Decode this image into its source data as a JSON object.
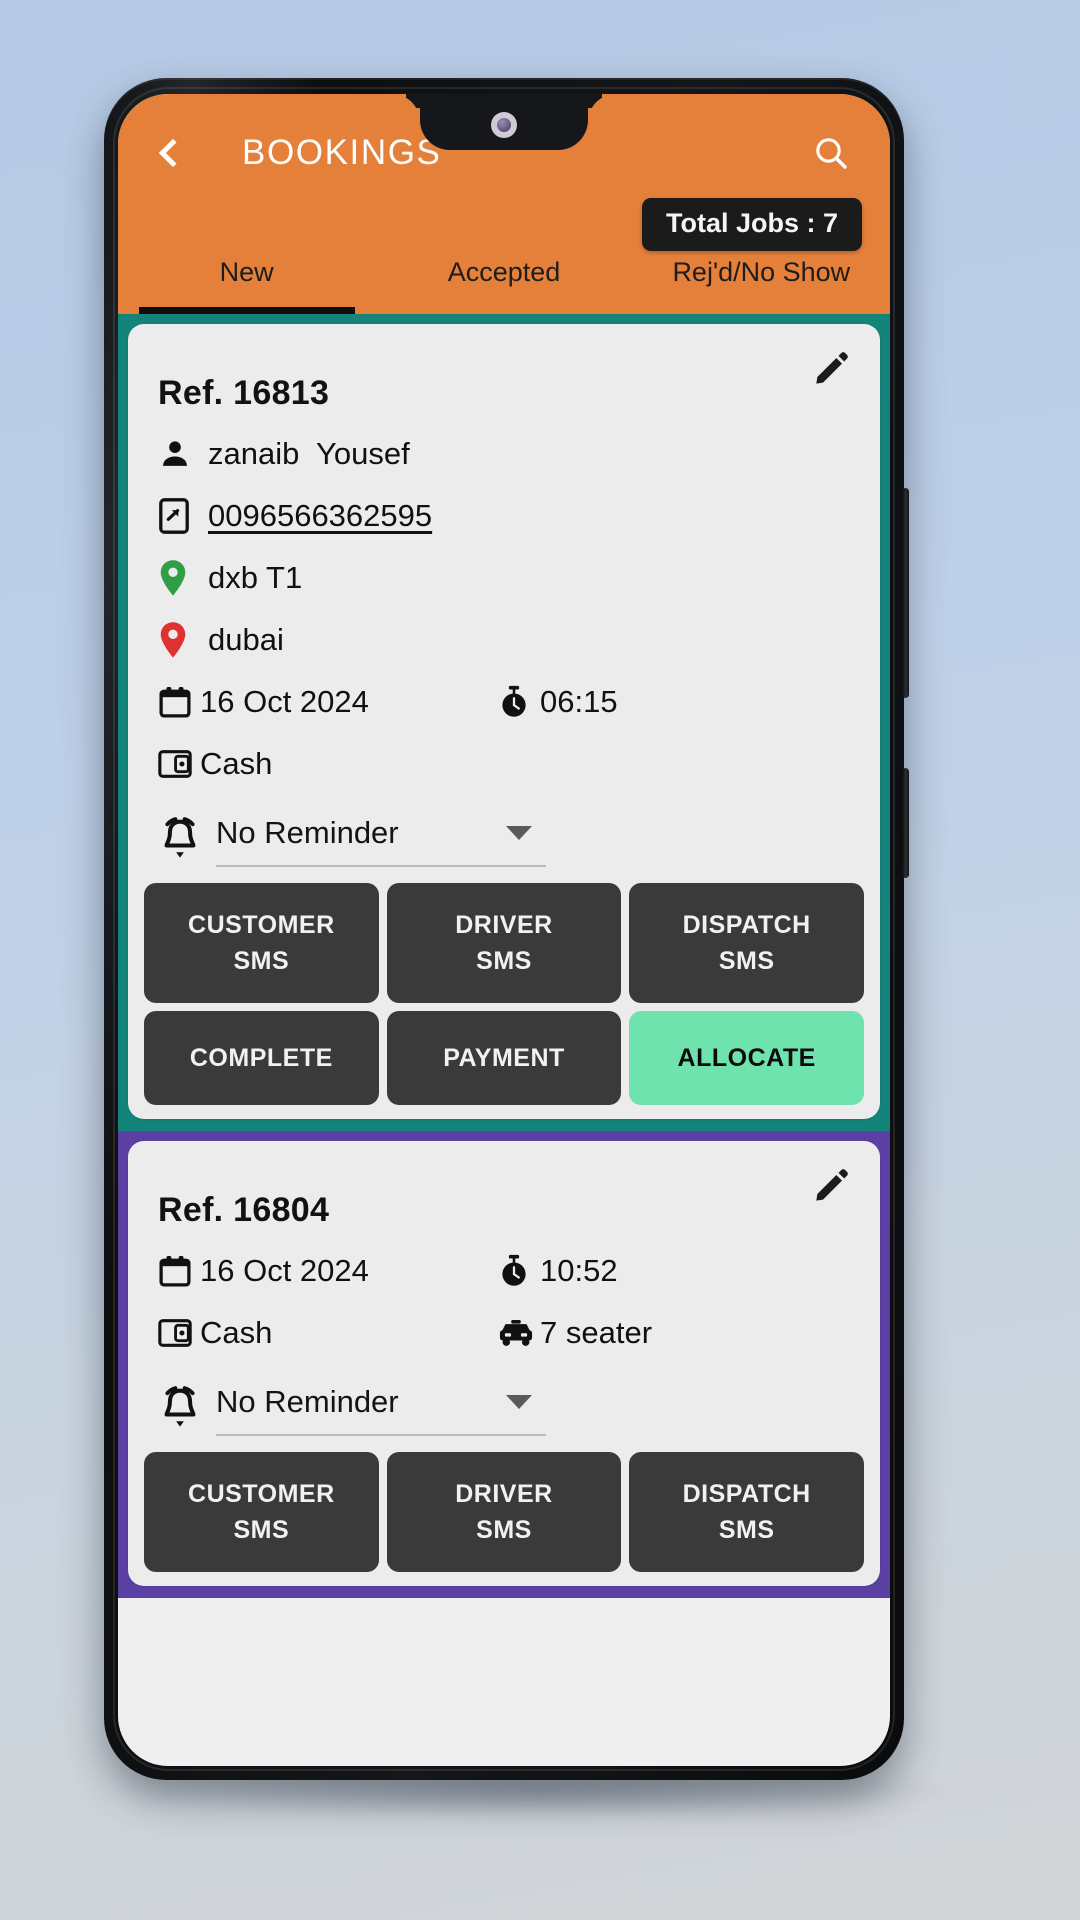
{
  "app": {
    "title": "BOOKINGS",
    "back_icon": "chevron-left-icon",
    "search_icon": "search-icon",
    "jobs_badge": "Total Jobs : 7",
    "accent_orange": "#e5803a",
    "badge_bg": "#1b1b1b"
  },
  "tabs": [
    {
      "label": "New",
      "active": true
    },
    {
      "label": "Accepted",
      "active": false
    },
    {
      "label": "Rej'd/No Show",
      "active": false
    }
  ],
  "bookings": [
    {
      "band_color": "#14837a",
      "ref": "Ref. 16813",
      "edit_icon": "pencil-icon",
      "customer": "zanaib  Yousef",
      "phone": "0096566362595",
      "pickup": "dxb T1",
      "dropoff": "dubai",
      "date": "16 Oct 2024",
      "time": "06:15",
      "payment": "Cash",
      "vehicle": "",
      "reminder": "No Reminder",
      "buttons": [
        {
          "line1": "CUSTOMER",
          "line2": "SMS",
          "style": "dark"
        },
        {
          "line1": "DRIVER",
          "line2": "SMS",
          "style": "dark"
        },
        {
          "line1": "DISPATCH",
          "line2": "SMS",
          "style": "dark"
        },
        {
          "line1": "COMPLETE",
          "line2": "",
          "style": "dark"
        },
        {
          "line1": "PAYMENT",
          "line2": "",
          "style": "dark"
        },
        {
          "line1": "ALLOCATE",
          "line2": "",
          "style": "green"
        }
      ]
    },
    {
      "band_color": "#5b3fa3",
      "ref": "Ref. 16804",
      "edit_icon": "pencil-icon",
      "customer": "",
      "phone": "",
      "pickup": "",
      "dropoff": "",
      "date": "16 Oct 2024",
      "time": "10:52",
      "payment": "Cash",
      "vehicle": "7 seater",
      "reminder": "No Reminder",
      "buttons": [
        {
          "line1": "CUSTOMER",
          "line2": "SMS",
          "style": "dark"
        },
        {
          "line1": "DRIVER",
          "line2": "SMS",
          "style": "dark"
        },
        {
          "line1": "DISPATCH",
          "line2": "SMS",
          "style": "dark"
        }
      ]
    }
  ]
}
